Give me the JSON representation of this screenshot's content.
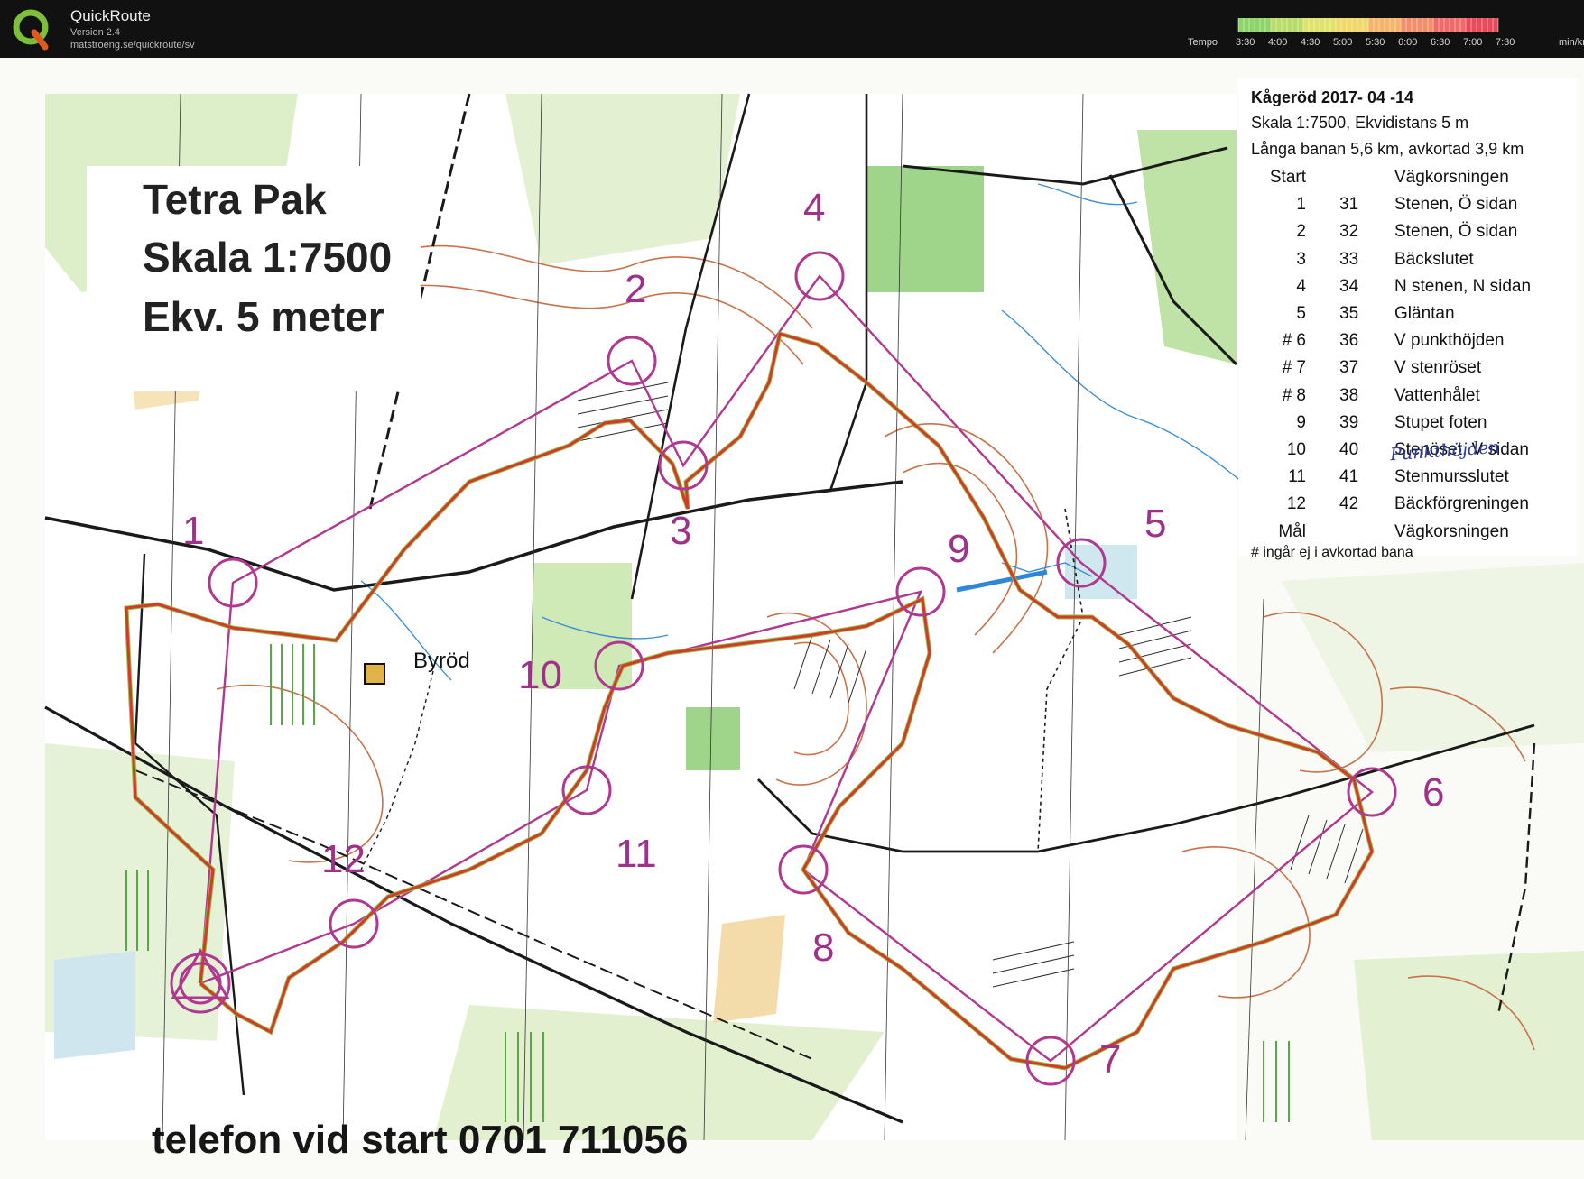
{
  "app": {
    "name": "QuickRoute",
    "version": "Version 2.4",
    "url": "matstroeng.se/quickroute/sv"
  },
  "tempo": {
    "label": "Tempo",
    "ticks": [
      "3:30",
      "4:00",
      "4:30",
      "5:00",
      "5:30",
      "6:00",
      "6:30",
      "7:00",
      "7:30"
    ],
    "unit": "min/km",
    "colors": [
      "#8fd36b",
      "#b8dc6a",
      "#dfe36a",
      "#f1d86b",
      "#f4b46a",
      "#f38e6a",
      "#f06a6a",
      "#e94b5a"
    ]
  },
  "map": {
    "title_lines": [
      "Tetra Pak",
      "Skala 1:7500",
      "Ekv. 5 meter"
    ],
    "phone": "telefon vid start 0701 711056",
    "place_name": "Byröd",
    "course_color": "#b1388f",
    "route_color": "#d23a2a",
    "control_labels": [
      "1",
      "2",
      "3",
      "4",
      "5",
      "6",
      "7",
      "8",
      "9",
      "10",
      "11",
      "12"
    ]
  },
  "legend": {
    "title": "Kågeröd 2017- 04 -14",
    "scale": "Skala 1:7500, Ekvidistans 5 m",
    "course": "Långa banan 5,6 km, avkortad 3,9 km",
    "rows": [
      {
        "num": "Start",
        "code": "",
        "desc": "Vägkorsningen"
      },
      {
        "num": "1",
        "code": "31",
        "desc": "Stenen, Ö sidan"
      },
      {
        "num": "2",
        "code": "32",
        "desc": "Stenen, Ö sidan"
      },
      {
        "num": "3",
        "code": "33",
        "desc": "Bäckslutet"
      },
      {
        "num": "4",
        "code": "34",
        "desc": "N stenen, N sidan"
      },
      {
        "num": "5",
        "code": "35",
        "desc": "Gläntan"
      },
      {
        "num": "# 6",
        "code": "36",
        "desc": "V punkthöjden"
      },
      {
        "num": "# 7",
        "code": "37",
        "desc": "V stenröset"
      },
      {
        "num": "# 8",
        "code": "38",
        "desc": "Vattenhålet"
      },
      {
        "num": "9",
        "code": "39",
        "desc": "Stupet foten"
      },
      {
        "num": "10",
        "code": "40",
        "desc": "Stenöset, V sidan"
      },
      {
        "num": "11",
        "code": "41",
        "desc": "Stenmursslutet"
      },
      {
        "num": "12",
        "code": "42",
        "desc": "Bäckförgreningen"
      },
      {
        "num": "Mål",
        "code": "",
        "desc": "Vägkorsningen"
      }
    ],
    "note": "# ingår ej i avkortad bana",
    "handwritten_note": "Punkthöjden"
  }
}
